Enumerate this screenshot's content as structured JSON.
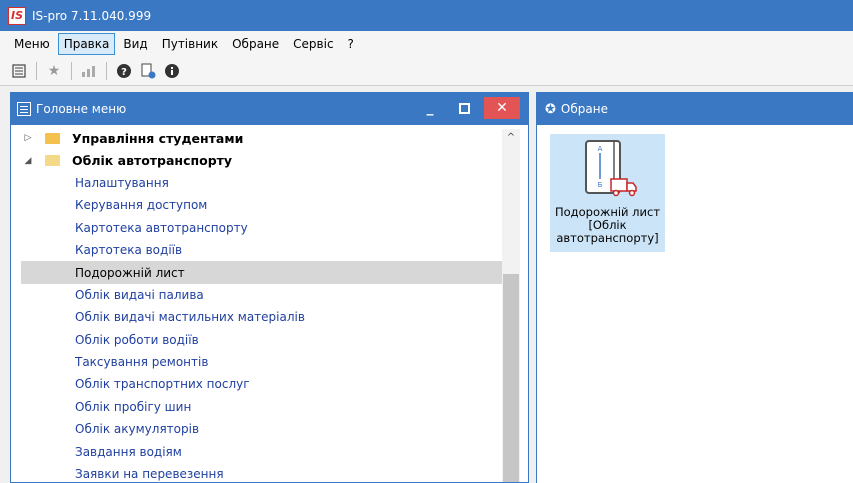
{
  "app": {
    "logo_text": "IS",
    "title": "IS-pro 7.11.040.999"
  },
  "menu": [
    "Меню",
    "Правка",
    "Вид",
    "Путівник",
    "Обране",
    "Сервіс",
    "?"
  ],
  "left_panel": {
    "title": "Головне меню",
    "tree": [
      {
        "type": "folder",
        "label": "Управління студентами",
        "expanded": false
      },
      {
        "type": "folder",
        "label": "Облік автотранспорту",
        "expanded": true
      },
      {
        "type": "leaf",
        "label": "Налаштування"
      },
      {
        "type": "leaf",
        "label": "Керування доступом"
      },
      {
        "type": "leaf",
        "label": "Картотека автотранспорту"
      },
      {
        "type": "leaf",
        "label": "Картотека водіїв"
      },
      {
        "type": "leaf",
        "label": "Подорожній лист",
        "selected": true
      },
      {
        "type": "leaf",
        "label": "Облік видачі палива"
      },
      {
        "type": "leaf",
        "label": "Облік видачі мастильних матеріалів"
      },
      {
        "type": "leaf",
        "label": "Облік роботи водіїв"
      },
      {
        "type": "leaf",
        "label": "Таксування ремонтів"
      },
      {
        "type": "leaf",
        "label": "Облік транспортних послуг"
      },
      {
        "type": "leaf",
        "label": "Облік пробігу шин"
      },
      {
        "type": "leaf",
        "label": "Облік акумуляторів"
      },
      {
        "type": "leaf",
        "label": "Завдання водіям"
      },
      {
        "type": "leaf",
        "label": "Заявки на перевезення"
      }
    ]
  },
  "right_panel": {
    "title": "Обране",
    "favorite": {
      "line1": "Подорожній лист",
      "line2": "[Облік",
      "line3": "автотранспорту]",
      "icon_letter_top": "А",
      "icon_letter_bottom": "Б"
    }
  },
  "colors": {
    "accent": "#3b78c4",
    "selected": "#d7d7d7",
    "link": "#1f3fa0",
    "close": "#e35454",
    "tile": "#cce4f7"
  }
}
